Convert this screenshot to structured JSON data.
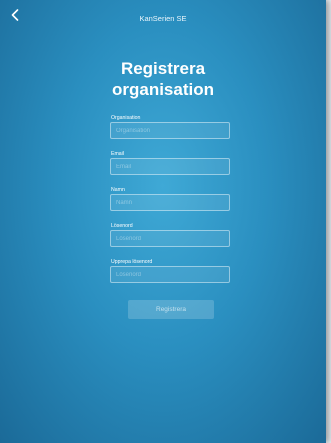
{
  "navbar": {
    "title": "KanSerien SE"
  },
  "page": {
    "title_line1": "Registrera",
    "title_line2": "organisation"
  },
  "form": {
    "organisation": {
      "label": "Organisation",
      "placeholder": "Organisation"
    },
    "email": {
      "label": "Email",
      "placeholder": "Email"
    },
    "name": {
      "label": "Namn",
      "placeholder": "Namn"
    },
    "password": {
      "label": "Lösenord",
      "placeholder": "Lösenord"
    },
    "password_repeat": {
      "label": "Upprepa lösenord",
      "placeholder": "Lösenord"
    },
    "submit_label": "Registrera"
  },
  "icons": {
    "back": "chevron-left-icon"
  },
  "colors": {
    "background": "#2a8fc0",
    "text": "#ffffff"
  }
}
